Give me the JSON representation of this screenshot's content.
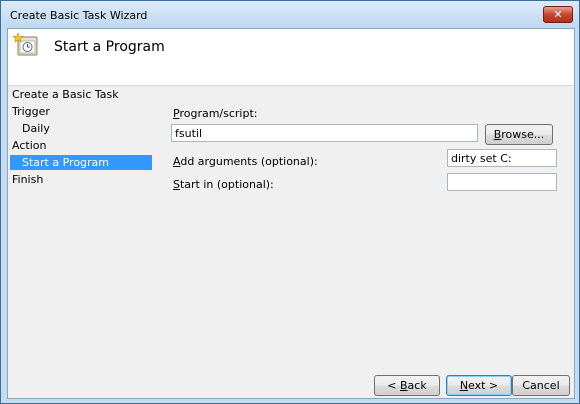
{
  "window": {
    "title": "Create Basic Task Wizard",
    "close_label": "✕"
  },
  "header": {
    "title": "Start a Program",
    "icon": "task-clock-icon"
  },
  "nav": {
    "items": [
      {
        "label": "Create a Basic Task",
        "indent": false,
        "selected": false
      },
      {
        "label": "Trigger",
        "indent": false,
        "selected": false
      },
      {
        "label": "Daily",
        "indent": true,
        "selected": false
      },
      {
        "label": "Action",
        "indent": false,
        "selected": false
      },
      {
        "label": "Start a Program",
        "indent": true,
        "selected": true
      },
      {
        "label": "Finish",
        "indent": false,
        "selected": false
      }
    ]
  },
  "form": {
    "program": {
      "label_ak": "P",
      "label_rest": "rogram/script:",
      "value": "fsutil"
    },
    "browse": {
      "ak": "B",
      "rest": "rowse..."
    },
    "arguments": {
      "label_ak": "A",
      "label_rest": "dd arguments (optional):",
      "value": "dirty set C:"
    },
    "start_in": {
      "label_ak": "S",
      "label_rest": "tart in (optional):",
      "value": ""
    }
  },
  "buttons": {
    "back": {
      "prefix": "< ",
      "ak": "B",
      "rest": "ack"
    },
    "next": {
      "ak": "N",
      "rest": "ext >"
    },
    "cancel": {
      "label": "Cancel"
    }
  }
}
